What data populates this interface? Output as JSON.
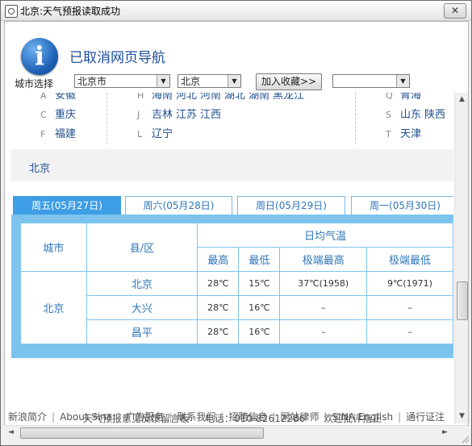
{
  "window": {
    "title": "北京:天气预报读取成功",
    "close_label": "✕"
  },
  "nav_message": "已取消网页导航",
  "toolbar": {
    "city_label": "城市选择",
    "province_value": "北京市",
    "city_value": "北京",
    "favorite_button": "加入收藏>>",
    "favorite_select_value": ""
  },
  "provinces": {
    "rows": [
      [
        {
          "letter": "A",
          "names": [
            "安徽"
          ]
        },
        {
          "letter": "H",
          "names": [
            "海南",
            "河北",
            "河南",
            "湖北",
            "湖南",
            "黑龙江"
          ]
        },
        {
          "letter": "Q",
          "names": [
            "青海"
          ]
        }
      ],
      [
        {
          "letter": "C",
          "names": [
            "重庆"
          ]
        },
        {
          "letter": "J",
          "names": [
            "吉林",
            "江苏",
            "江西"
          ]
        },
        {
          "letter": "S",
          "names": [
            "山东",
            "陕西"
          ]
        }
      ],
      [
        {
          "letter": "F",
          "names": [
            "福建"
          ]
        },
        {
          "letter": "L",
          "names": [
            "辽宁"
          ]
        },
        {
          "letter": "T",
          "names": [
            "天津"
          ]
        }
      ]
    ]
  },
  "current_city": "北京",
  "tabs": [
    {
      "label": "周五(05月27日)"
    },
    {
      "label": "周六(05月28日)"
    },
    {
      "label": "周日(05月29日)"
    },
    {
      "label": "周一(05月30日)"
    }
  ],
  "table": {
    "header_city": "城市",
    "header_district": "县/区",
    "header_group": "日均气温",
    "sub_headers": [
      "最高",
      "最低",
      "极端最高",
      "极端最低"
    ],
    "city": "北京",
    "rows": [
      {
        "district": "北京",
        "high": "28℃",
        "low": "15℃",
        "ext_high": "37℃(1958)",
        "ext_low": "9℃(1971)"
      },
      {
        "district": "大兴",
        "high": "28℃",
        "low": "16℃",
        "ext_high": "–",
        "ext_low": "–"
      },
      {
        "district": "昌平",
        "high": "28℃",
        "low": "16℃",
        "ext_high": "–",
        "ext_low": "–"
      }
    ]
  },
  "footer": {
    "feedback": "天气预报意见反馈留言板",
    "phone_label": "电话：",
    "phone": "010-82612286",
    "welcome": "欢迎批评指正",
    "links": [
      "新浪简介",
      "About Sina",
      "广告服务",
      "联系我们",
      "招聘信息",
      "网站律师",
      "SINA English",
      "通行证注"
    ]
  },
  "scrollbars": {
    "up": "▲",
    "down": "▼",
    "left": "◄",
    "right": "►"
  }
}
